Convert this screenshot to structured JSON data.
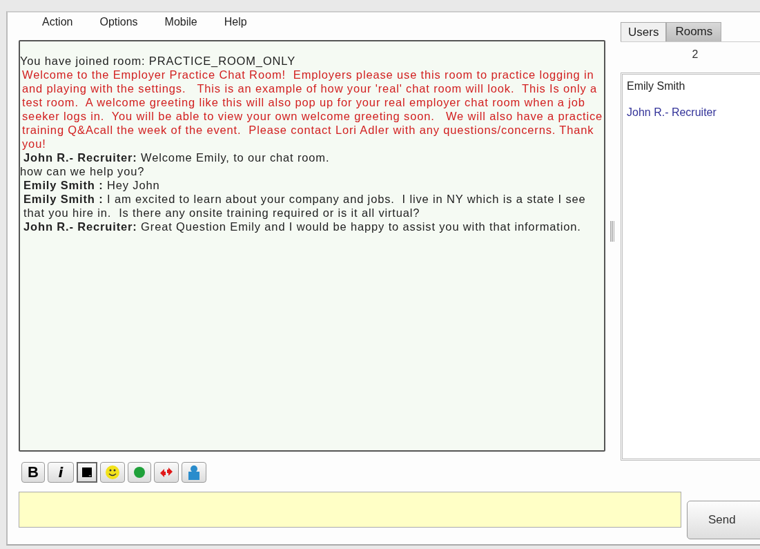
{
  "menu": [
    "Action",
    "Options",
    "Mobile",
    "Help"
  ],
  "messages": [
    {
      "kind": "system",
      "text": "You have joined room: PRACTICE_ROOM_ONLY"
    },
    {
      "kind": "welcome",
      "text": "Welcome to the Employer Practice Chat Room!  Employers please use this room to practice logging in and playing with the settings.   This is an example of how your 'real' chat room will look.  This Is only a test room.  A welcome greeting like this will also pop up for your real employer chat room when a job seeker logs in.  You will be able to view your own welcome greeting soon.   We will also have a practice training Q&Acall the week of the event.  Please contact Lori Adler with any questions/concerns. Thank you!"
    },
    {
      "kind": "chat",
      "sender": "John R.- Recruiter:",
      "text": "Welcome Emily, to our chat room."
    },
    {
      "kind": "plain",
      "text": "how can we help you?"
    },
    {
      "kind": "chat",
      "sender": "Emily Smith :",
      "text": "Hey John"
    },
    {
      "kind": "chat",
      "sender": "Emily Smith :",
      "text": "I am excited to learn about your company and jobs.  I live in NY which is a state I see that you hire in.  Is there any onsite training required or is it all virtual?"
    },
    {
      "kind": "chat",
      "sender": "John R.- Recruiter:",
      "text": "Great Question Emily and I would be happy to assist you with that information."
    }
  ],
  "tabs": [
    {
      "label": "Users",
      "selected": true
    },
    {
      "label": "Rooms",
      "selected": false
    }
  ],
  "user_count": "2",
  "users": [
    {
      "name": "Emily Smith",
      "color": "#222222"
    },
    {
      "name": "John R.- Recruiter",
      "color": "#333399"
    }
  ],
  "toolbar": [
    {
      "kind": "bold",
      "label": "B"
    },
    {
      "kind": "italic",
      "label": "i"
    },
    {
      "kind": "color"
    },
    {
      "kind": "smiley"
    },
    {
      "kind": "status"
    },
    {
      "kind": "arrows"
    },
    {
      "kind": "person"
    }
  ],
  "send_button": "Send"
}
